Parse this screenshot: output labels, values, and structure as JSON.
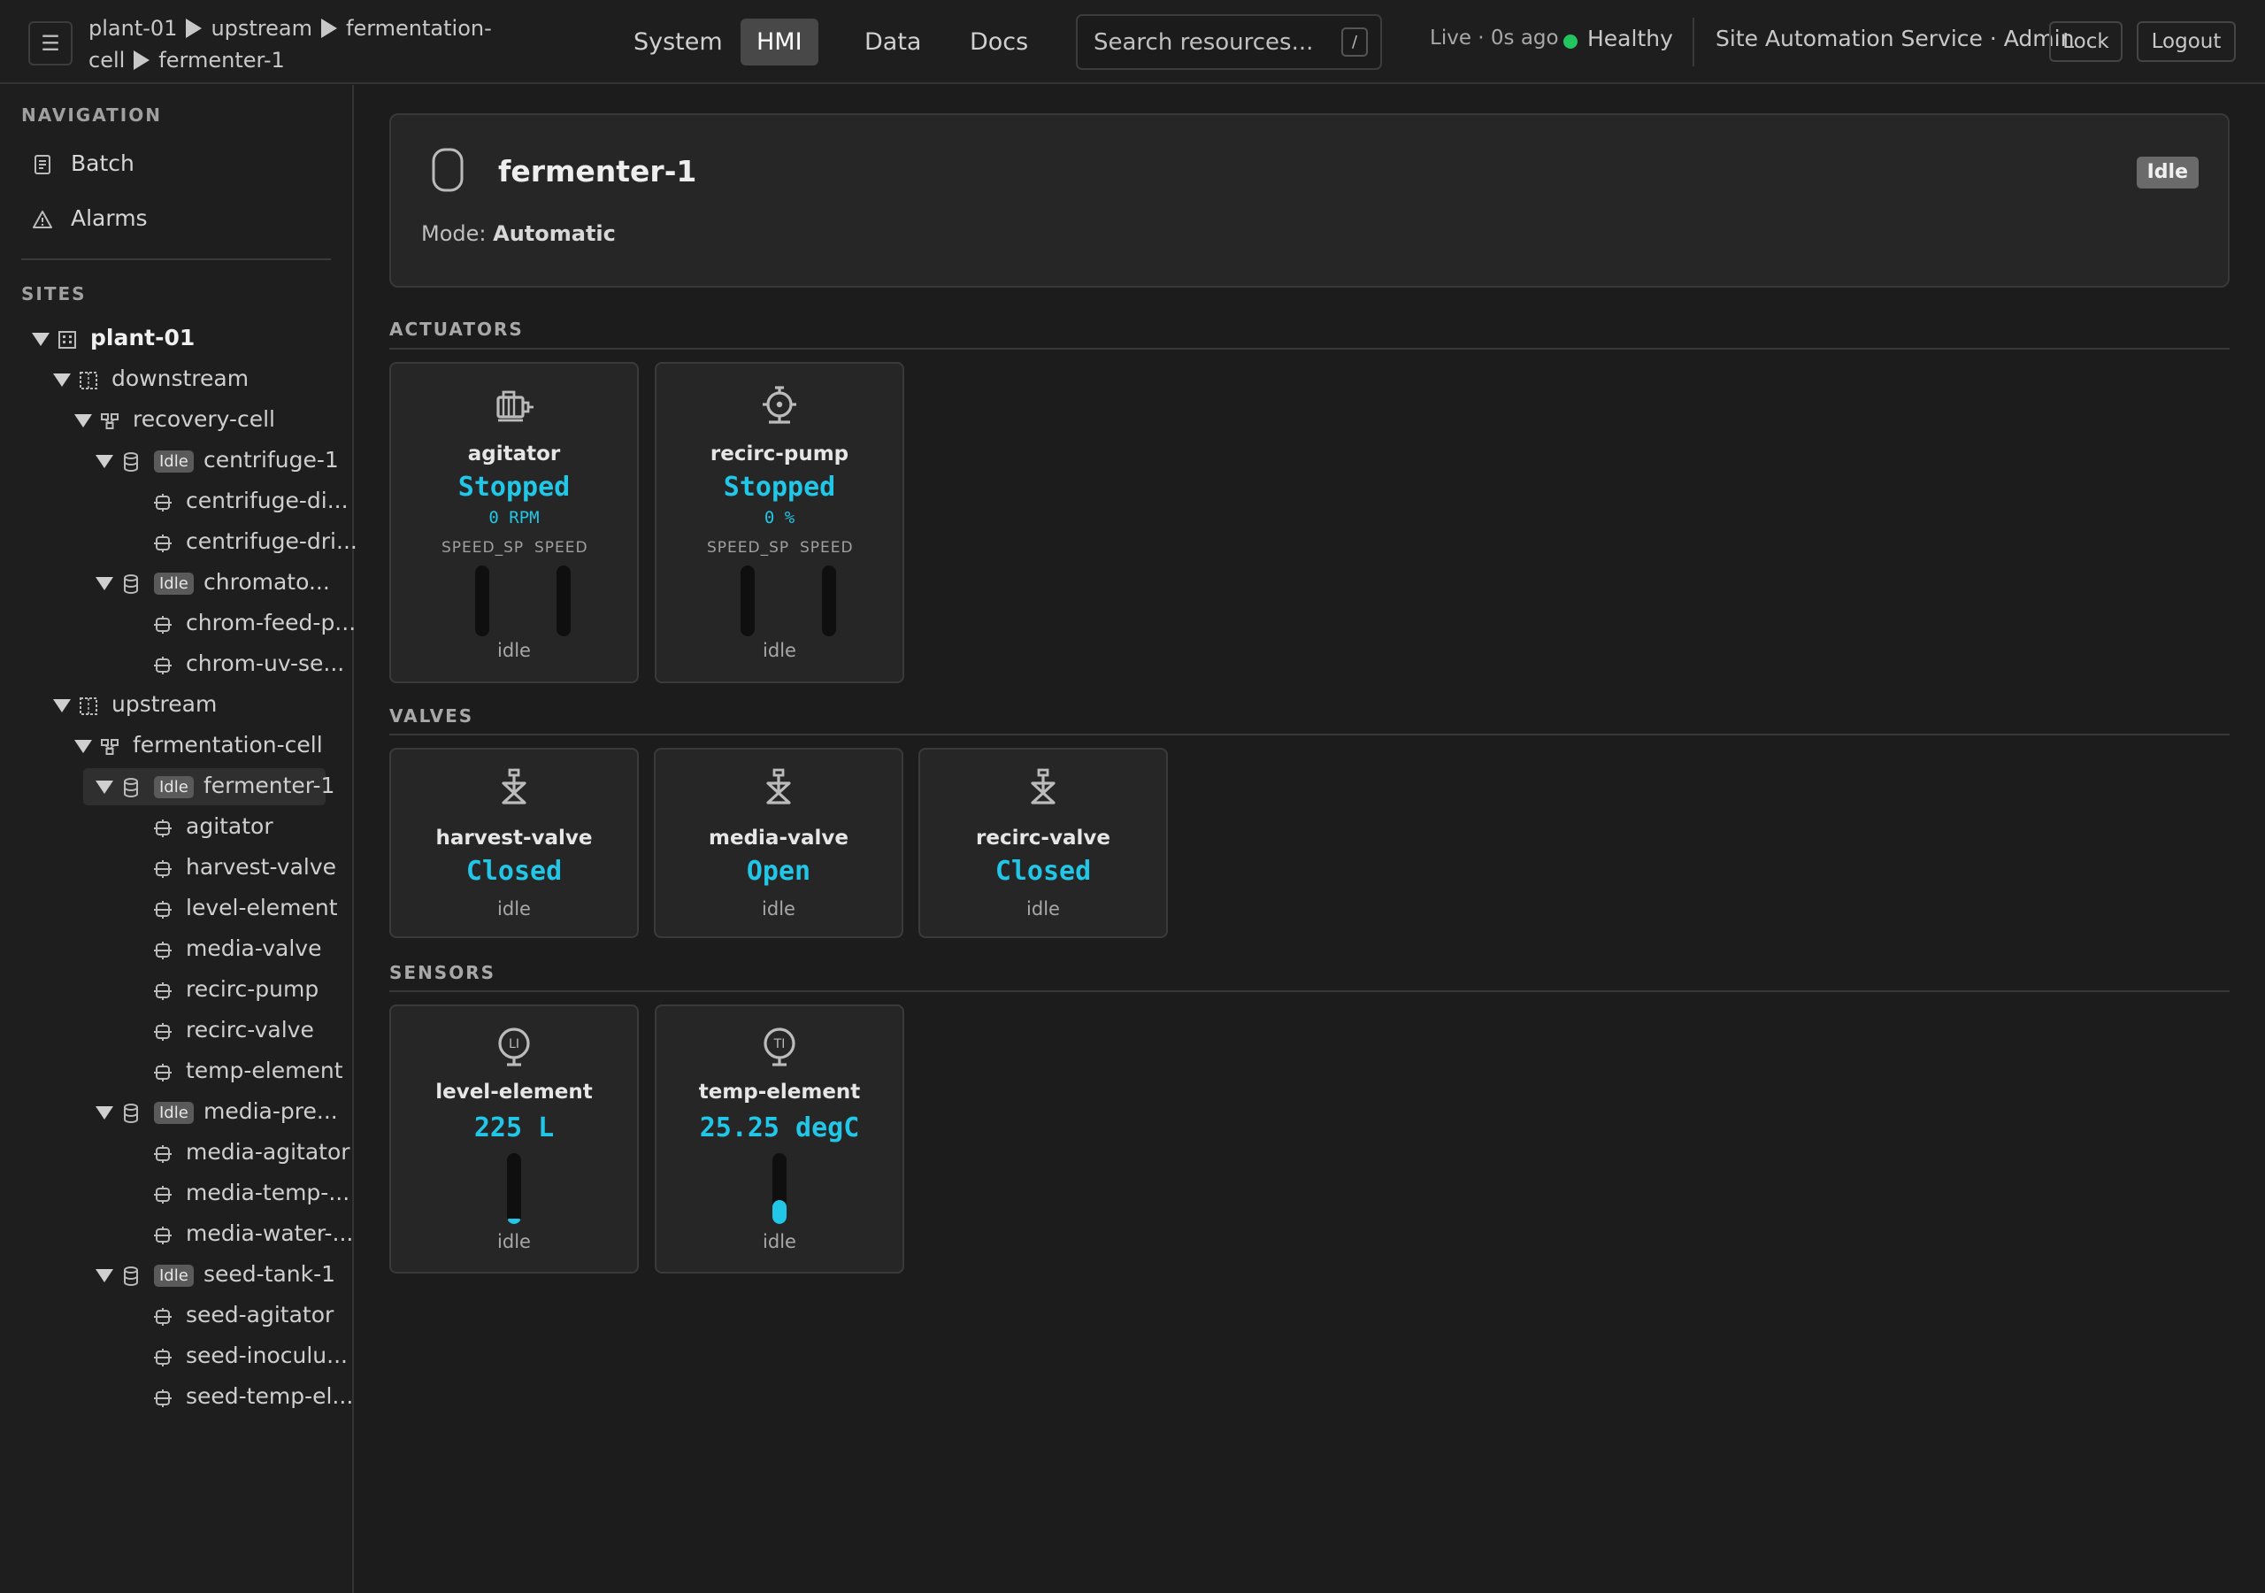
{
  "header": {
    "menu_icon": "hamburger-icon",
    "breadcrumb": [
      "plant-01",
      "upstream",
      "fermentation-cell",
      "fermenter-1"
    ],
    "tabs": [
      {
        "label": "System",
        "active": false
      },
      {
        "label": "HMI",
        "active": true
      },
      {
        "label": "Data",
        "active": false
      },
      {
        "label": "Docs",
        "active": false
      }
    ],
    "search": {
      "placeholder": "Search resources...",
      "shortcut": "/"
    },
    "live": "Live · 0s ago",
    "health": "Healthy",
    "health_color": "#22c55e",
    "user": "Site Automation Service · Admin",
    "lock_label": "Lock",
    "logout_label": "Logout"
  },
  "sidebar": {
    "nav_title": "NAVIGATION",
    "nav_items": [
      {
        "label": "Batch",
        "icon": "document-icon"
      },
      {
        "label": "Alarms",
        "icon": "warning-icon"
      }
    ],
    "sites_title": "SITES",
    "tree": [
      {
        "label": "plant-01",
        "level": 0,
        "expanded": true,
        "icon": "site-icon"
      },
      {
        "label": "downstream",
        "level": 1,
        "expanded": true,
        "icon": "area-icon"
      },
      {
        "label": "recovery-cell",
        "level": 2,
        "expanded": true,
        "icon": "cell-icon"
      },
      {
        "label": "centrifuge-1",
        "level": 3,
        "expanded": true,
        "icon": "unit-icon",
        "badge": "Idle"
      },
      {
        "label": "centrifuge-di...",
        "level": 4,
        "icon": "module-icon"
      },
      {
        "label": "centrifuge-dri...",
        "level": 4,
        "icon": "module-icon"
      },
      {
        "label": "chromato...",
        "level": 3,
        "expanded": true,
        "icon": "unit-icon",
        "badge": "Idle"
      },
      {
        "label": "chrom-feed-p...",
        "level": 4,
        "icon": "module-icon"
      },
      {
        "label": "chrom-uv-se...",
        "level": 4,
        "icon": "module-icon"
      },
      {
        "label": "upstream",
        "level": 1,
        "expanded": true,
        "icon": "area-icon"
      },
      {
        "label": "fermentation-cell",
        "level": 2,
        "expanded": true,
        "icon": "cell-icon"
      },
      {
        "label": "fermenter-1",
        "level": 3,
        "expanded": true,
        "icon": "unit-icon",
        "badge": "Idle",
        "selected": true
      },
      {
        "label": "agitator",
        "level": 4,
        "icon": "module-icon"
      },
      {
        "label": "harvest-valve",
        "level": 4,
        "icon": "module-icon"
      },
      {
        "label": "level-element",
        "level": 4,
        "icon": "module-icon"
      },
      {
        "label": "media-valve",
        "level": 4,
        "icon": "module-icon"
      },
      {
        "label": "recirc-pump",
        "level": 4,
        "icon": "module-icon"
      },
      {
        "label": "recirc-valve",
        "level": 4,
        "icon": "module-icon"
      },
      {
        "label": "temp-element",
        "level": 4,
        "icon": "module-icon"
      },
      {
        "label": "media-pre...",
        "level": 3,
        "expanded": true,
        "icon": "unit-icon",
        "badge": "Idle"
      },
      {
        "label": "media-agitator",
        "level": 4,
        "icon": "module-icon"
      },
      {
        "label": "media-temp-...",
        "level": 4,
        "icon": "module-icon"
      },
      {
        "label": "media-water-...",
        "level": 4,
        "icon": "module-icon"
      },
      {
        "label": "seed-tank-1",
        "level": 3,
        "expanded": true,
        "icon": "unit-icon",
        "badge": "Idle"
      },
      {
        "label": "seed-agitator",
        "level": 4,
        "icon": "module-icon"
      },
      {
        "label": "seed-inoculu...",
        "level": 4,
        "icon": "module-icon"
      },
      {
        "label": "seed-temp-el...",
        "level": 4,
        "icon": "module-icon"
      }
    ]
  },
  "unit": {
    "icon": "vessel-icon",
    "name": "fermenter-1",
    "mode_label": "Mode:",
    "mode": "Automatic",
    "state": "Idle"
  },
  "accent_color": "#22c6e6",
  "sections": {
    "actuators": "ACTUATORS",
    "valves": "VALVES",
    "sensors": "SENSORS"
  },
  "actuators": [
    {
      "name": "agitator",
      "icon": "motor-icon",
      "state": "Stopped",
      "value": "0 RPM",
      "bar_labels": [
        "SPEED_SP",
        "SPEED"
      ],
      "bar_levels": [
        0,
        0
      ],
      "status": "idle"
    },
    {
      "name": "recirc-pump",
      "icon": "pump-icon",
      "state": "Stopped",
      "value": "0 %",
      "bar_labels": [
        "SPEED_SP",
        "SPEED"
      ],
      "bar_levels": [
        0,
        0
      ],
      "status": "idle"
    }
  ],
  "valves": [
    {
      "name": "harvest-valve",
      "icon": "valve-icon",
      "state": "Closed",
      "status": "idle"
    },
    {
      "name": "media-valve",
      "icon": "valve-icon",
      "state": "Open",
      "status": "idle"
    },
    {
      "name": "recirc-valve",
      "icon": "valve-icon",
      "state": "Closed",
      "status": "idle"
    }
  ],
  "sensors": [
    {
      "name": "level-element",
      "icon": "level-indicator-icon",
      "tag": "LI",
      "value": "225 L",
      "level": 0.03,
      "status": "idle"
    },
    {
      "name": "temp-element",
      "icon": "temperature-indicator-icon",
      "tag": "TI",
      "value": "25.25 degC",
      "level": 0.34,
      "status": "idle"
    }
  ]
}
